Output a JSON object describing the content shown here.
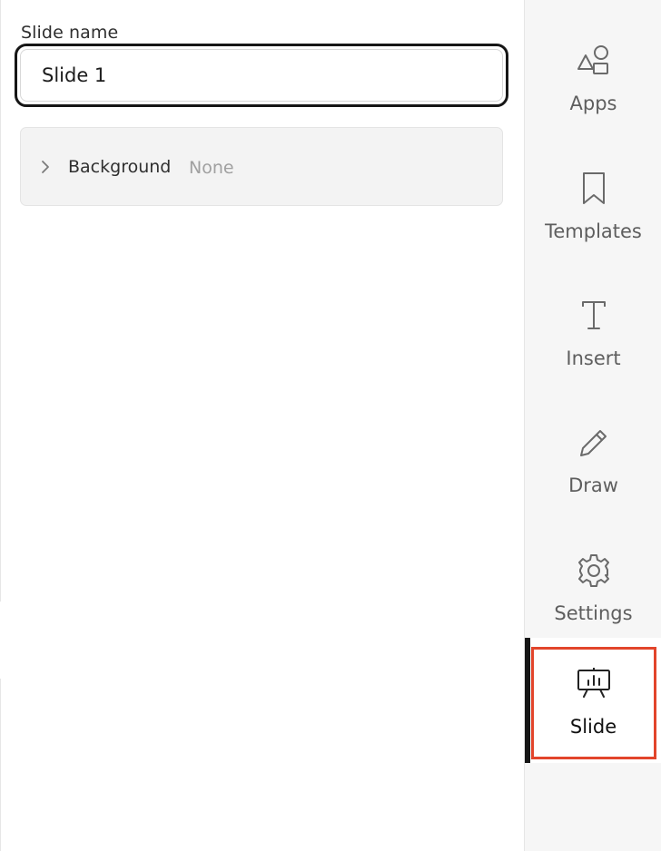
{
  "slide_name": {
    "label": "Slide name",
    "value": "Slide 1"
  },
  "background": {
    "label": "Background",
    "value": "None"
  },
  "sidebar": {
    "items": [
      {
        "label": "Apps",
        "icon": "apps-shapes-icon"
      },
      {
        "label": "Templates",
        "icon": "bookmark-icon"
      },
      {
        "label": "Insert",
        "icon": "text-insert-icon"
      },
      {
        "label": "Draw",
        "icon": "pencil-icon"
      },
      {
        "label": "Settings",
        "icon": "gear-icon"
      },
      {
        "label": "Slide",
        "icon": "presentation-chart-icon",
        "active": true
      }
    ]
  },
  "colors": {
    "active_highlight": "#e2452b",
    "active_bar": "#161616",
    "sidebar_bg": "#f6f6f6",
    "row_bg": "#f3f3f3"
  }
}
